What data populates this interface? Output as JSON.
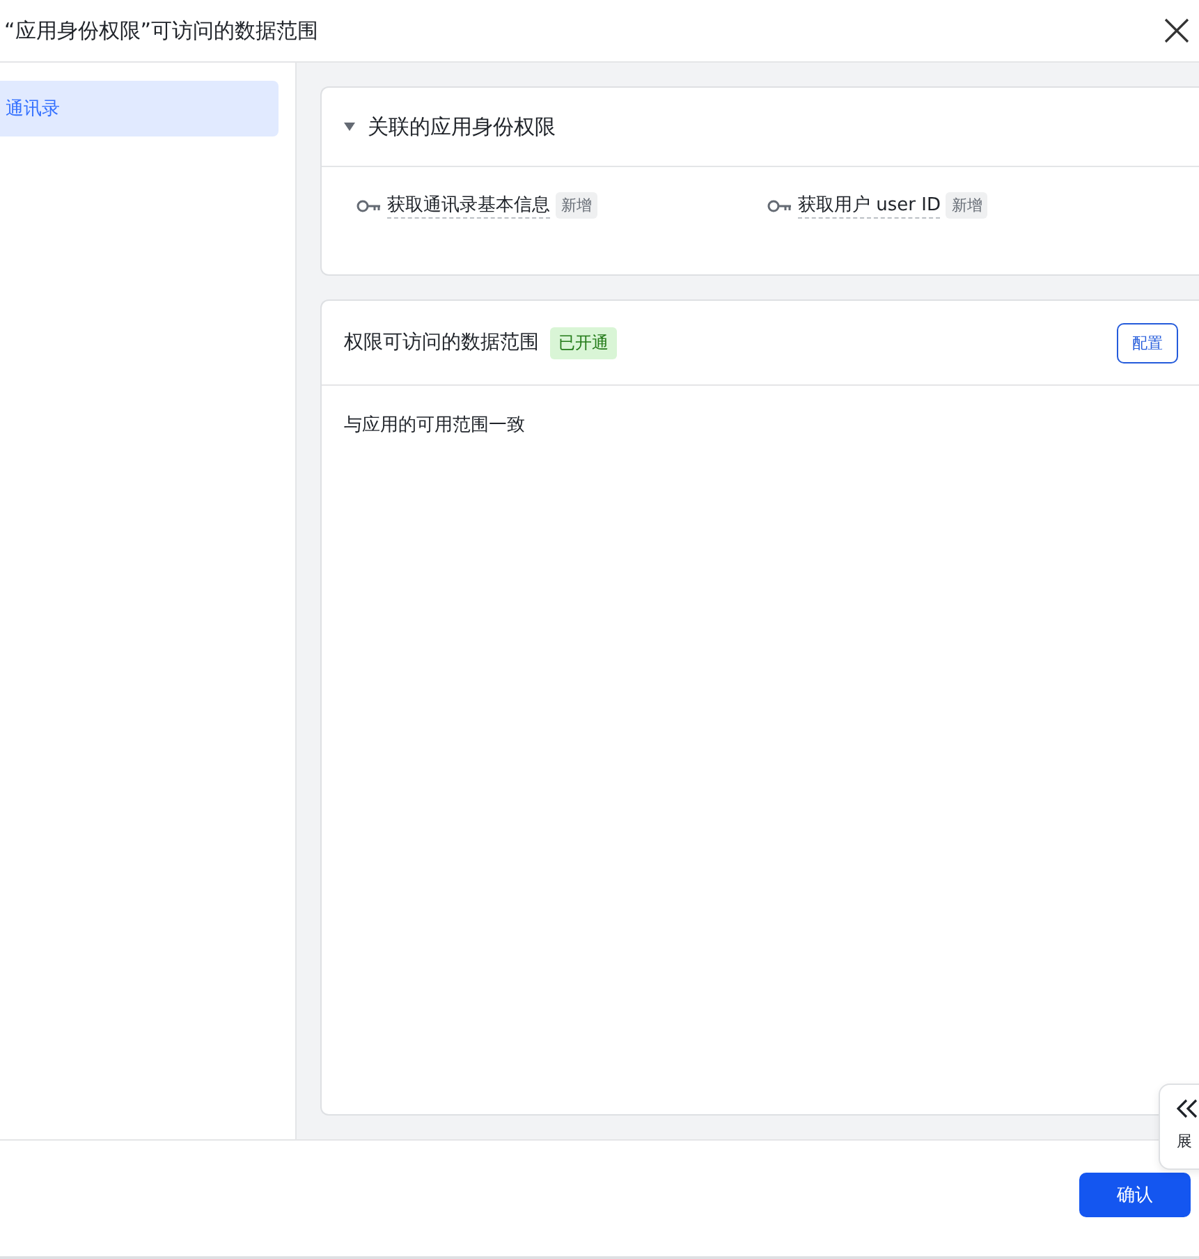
{
  "window": {
    "title": "“应用身份权限”可访问的数据范围"
  },
  "sidebar": {
    "items": [
      {
        "label": "通讯录",
        "selected": true
      }
    ]
  },
  "related_permissions": {
    "title": "关联的应用身份权限",
    "expanded": true,
    "items": [
      {
        "label": "获取通讯录基本信息",
        "badge": "新增"
      },
      {
        "label": "获取用户 user ID",
        "badge": "新增"
      }
    ]
  },
  "data_scope": {
    "title": "权限可访问的数据范围",
    "status": "已开通",
    "config_button": "配置",
    "description": "与应用的可用范围一致"
  },
  "floating_tab": {
    "label": "展"
  },
  "buttons": [
    {
      "label": "确认"
    }
  ]
}
